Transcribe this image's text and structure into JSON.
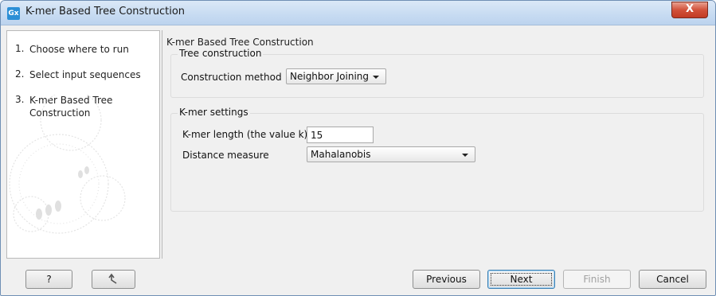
{
  "window": {
    "app_icon": "Gx",
    "title": "K-mer Based Tree Construction",
    "close_label": "X"
  },
  "sidebar": {
    "steps": [
      {
        "num": "1.",
        "label": "Choose where to run"
      },
      {
        "num": "2.",
        "label": "Select input sequences"
      },
      {
        "num": "3.",
        "label": "K-mer Based Tree Construction"
      }
    ]
  },
  "content": {
    "title": "K-mer Based Tree Construction",
    "tree_construction": {
      "group_title": "Tree construction",
      "method_label": "Construction method",
      "method_value": "Neighbor Joining"
    },
    "kmer_settings": {
      "group_title": "K-mer settings",
      "length_label": "K-mer length (the value k)",
      "length_value": "15",
      "distance_label": "Distance measure",
      "distance_value": "Mahalanobis"
    }
  },
  "footer": {
    "help_label": "?",
    "reset_icon": "reset-arrow-icon",
    "previous_label": "Previous",
    "next_label": "Next",
    "finish_label": "Finish",
    "cancel_label": "Cancel"
  }
}
